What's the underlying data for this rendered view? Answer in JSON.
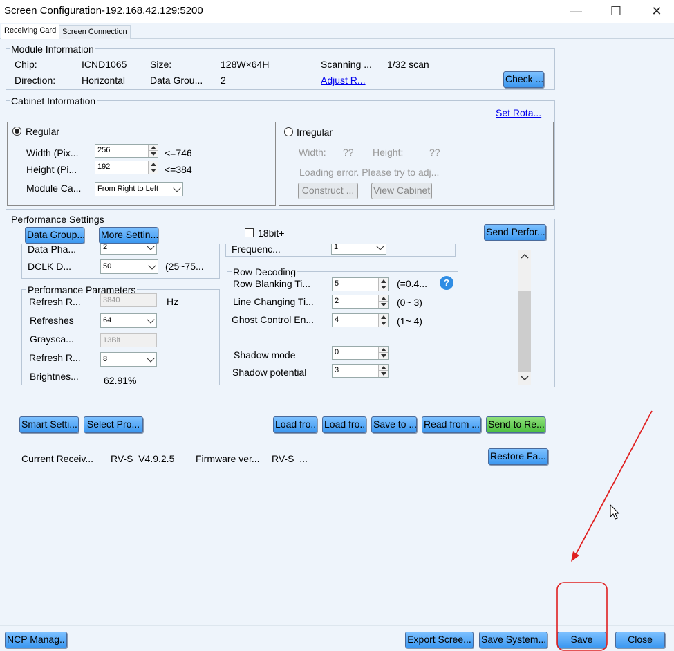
{
  "window": {
    "title": "Screen Configuration-192.168.42.129:5200",
    "minimize_glyph": "—",
    "maximize_glyph": "☐",
    "close_glyph": "✕"
  },
  "tabs": [
    {
      "label": "Receiving Card",
      "active": true
    },
    {
      "label": "Screen Connection",
      "active": false
    }
  ],
  "module": {
    "title": "Module Information",
    "chip_label": "Chip:",
    "chip_value": "ICND1065",
    "size_label": "Size:",
    "size_value": "128W×64H",
    "scanning_label": "Scanning ...",
    "scanning_value": "1/32 scan",
    "direction_label": "Direction:",
    "direction_value": "Horizontal",
    "datagroup_label": "Data Grou...",
    "datagroup_value": "2",
    "adjust_link": "Adjust R...",
    "check_button": "Check ..."
  },
  "cabinet": {
    "title": "Cabinet Information",
    "set_rotation_link": "Set Rota...",
    "regular_label": "Regular",
    "width_label": "Width (Pix...",
    "width_value": "256",
    "width_limit": "<=746",
    "height_label": "Height (Pi...",
    "height_value": "192",
    "height_limit": "<=384",
    "module_cascade_label": "Module Ca...",
    "module_cascade_value": "From Right to Left",
    "irregular_label": "Irregular",
    "irr_width_label": "Width:",
    "irr_width_value": "??",
    "irr_height_label": "Height:",
    "irr_height_value": "??",
    "loading_error": "Loading error. Please try to adj...",
    "construct_button": "Construct ...",
    "view_cabinet_button": "View Cabinet"
  },
  "performance": {
    "title": "Performance Settings",
    "data_group_button": "Data Group...",
    "more_settings_button": "More Settin...",
    "bit18_label": "18bit+",
    "send_button": "Send Perfor...",
    "data_phase_label": "Data Pha...",
    "data_phase_value": "2",
    "frequency_label": "Frequenc...",
    "frequency_value": "1",
    "dclk_label": "DCLK D...",
    "dclk_value": "50",
    "dclk_range": "(25~75...",
    "params_title": "Performance Parameters",
    "refresh_rate_label": "Refresh R...",
    "refresh_rate_value": "3840",
    "refresh_rate_unit": "Hz",
    "refreshes_label": "Refreshes",
    "refreshes_value": "64",
    "grayscale_label": "Graysca...",
    "grayscale_value": "13Bit",
    "refresh_ratio_label": "Refresh R...",
    "refresh_ratio_value": "8",
    "brightness_label": "Brightnes...",
    "brightness_value": "62.91%",
    "row_decoding_title": "Row Decoding",
    "row_blanking_label": "Row Blanking Ti...",
    "row_blanking_value": "5",
    "row_blanking_range": "(=0.4...",
    "line_changing_label": "Line Changing Ti...",
    "line_changing_value": "2",
    "line_changing_range": "(0~ 3)",
    "ghost_label": "Ghost Control En...",
    "ghost_value": "4",
    "ghost_range": "(1~ 4)",
    "help_glyph": "?",
    "shadow_mode_label": "Shadow mode",
    "shadow_mode_value": "0",
    "shadow_potential_label": "Shadow potential",
    "shadow_potential_value": "3"
  },
  "actions": {
    "smart_settings": "Smart Setti...",
    "select_profile": "Select Pro...",
    "load_from_1": "Load fro...",
    "load_from_2": "Load fro...",
    "save_to": "Save to ...",
    "read_from": "Read from ...",
    "send_to": "Send to Re...",
    "restore": "Restore Fa..."
  },
  "version": {
    "receiving_label": "Current Receiv...",
    "receiving_value": "RV-S_V4.9.2.5",
    "firmware_label": "Firmware ver...",
    "firmware_value": "RV-S_..."
  },
  "bottom": {
    "ncp_manager": "NCP Manag...",
    "export_screen": "Export Scree...",
    "save_system": "Save System...",
    "save": "Save",
    "close": "Close"
  },
  "annotation": {
    "color": "#e02020"
  }
}
